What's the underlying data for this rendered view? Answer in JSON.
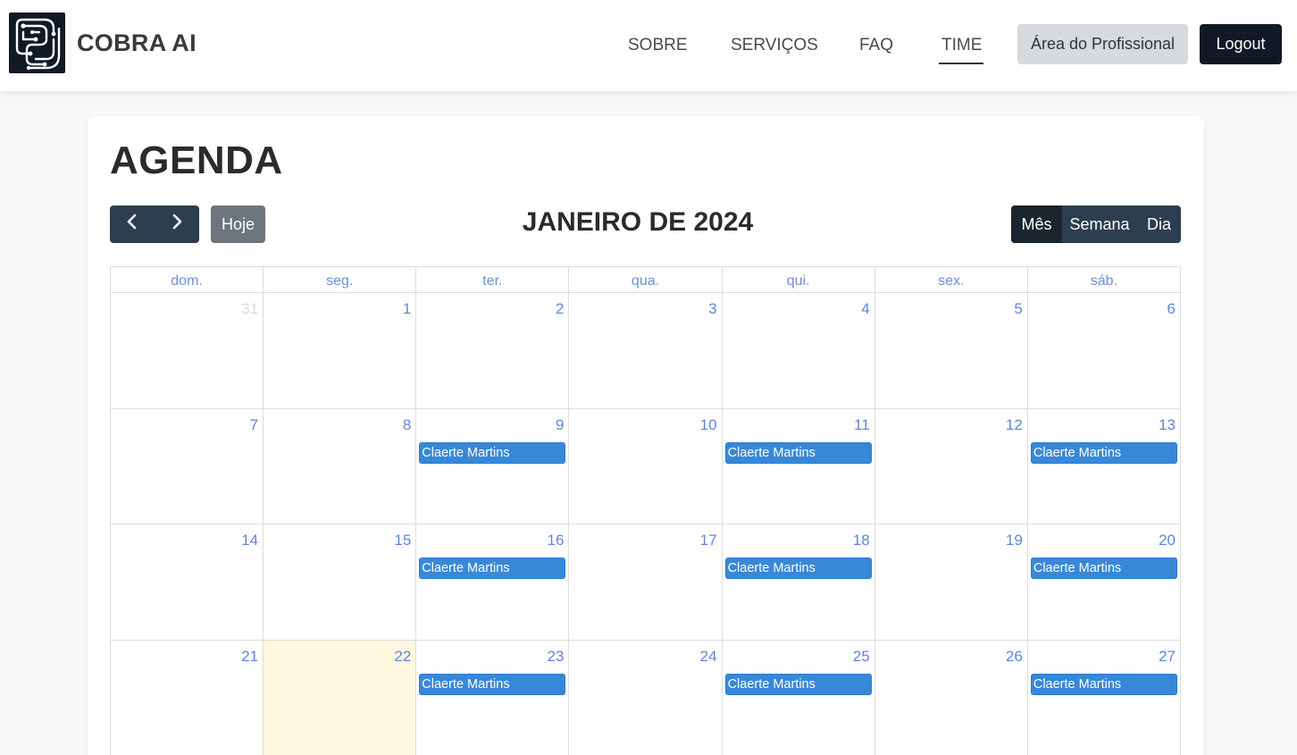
{
  "header": {
    "brand": "COBRA AI",
    "logo_icon": "snake-circuit-logo-icon",
    "nav": {
      "sobre": "SOBRE",
      "servicos": "SERVIÇOS",
      "faq": "FAQ",
      "time": "TIME"
    },
    "active_nav": "TIME",
    "area_label": "Área do Profissional",
    "logout_label": "Logout"
  },
  "page": {
    "title": "AGENDA"
  },
  "toolbar": {
    "prev_icon": "chevron-left-icon",
    "next_icon": "chevron-right-icon",
    "prev_glyph": "‹",
    "next_glyph": "›",
    "today_label": "Hoje",
    "title": "JANEIRO DE 2024",
    "views": [
      "Mês",
      "Semana",
      "Dia"
    ],
    "active_view": "Mês"
  },
  "calendar": {
    "weekdays": [
      "dom.",
      "seg.",
      "ter.",
      "qua.",
      "qui.",
      "sex.",
      "sáb."
    ],
    "weeks": [
      [
        {
          "day": "31",
          "other": true
        },
        {
          "day": "1"
        },
        {
          "day": "2"
        },
        {
          "day": "3"
        },
        {
          "day": "4"
        },
        {
          "day": "5"
        },
        {
          "day": "6"
        }
      ],
      [
        {
          "day": "7"
        },
        {
          "day": "8"
        },
        {
          "day": "9",
          "event": "Claerte Martins"
        },
        {
          "day": "10"
        },
        {
          "day": "11",
          "event": "Claerte Martins"
        },
        {
          "day": "12"
        },
        {
          "day": "13",
          "event": "Claerte Martins"
        }
      ],
      [
        {
          "day": "14"
        },
        {
          "day": "15"
        },
        {
          "day": "16",
          "event": "Claerte Martins"
        },
        {
          "day": "17"
        },
        {
          "day": "18",
          "event": "Claerte Martins"
        },
        {
          "day": "19"
        },
        {
          "day": "20",
          "event": "Claerte Martins"
        }
      ],
      [
        {
          "day": "21"
        },
        {
          "day": "22",
          "today": true
        },
        {
          "day": "23",
          "event": "Claerte Martins"
        },
        {
          "day": "24"
        },
        {
          "day": "25",
          "event": "Claerte Martins"
        },
        {
          "day": "26"
        },
        {
          "day": "27",
          "event": "Claerte Martins"
        }
      ]
    ]
  },
  "colors": {
    "primary_dark": "#2c3e50",
    "event_blue": "#3888d8",
    "today_bg": "#fff8df",
    "day_number": "#5f86d8"
  }
}
